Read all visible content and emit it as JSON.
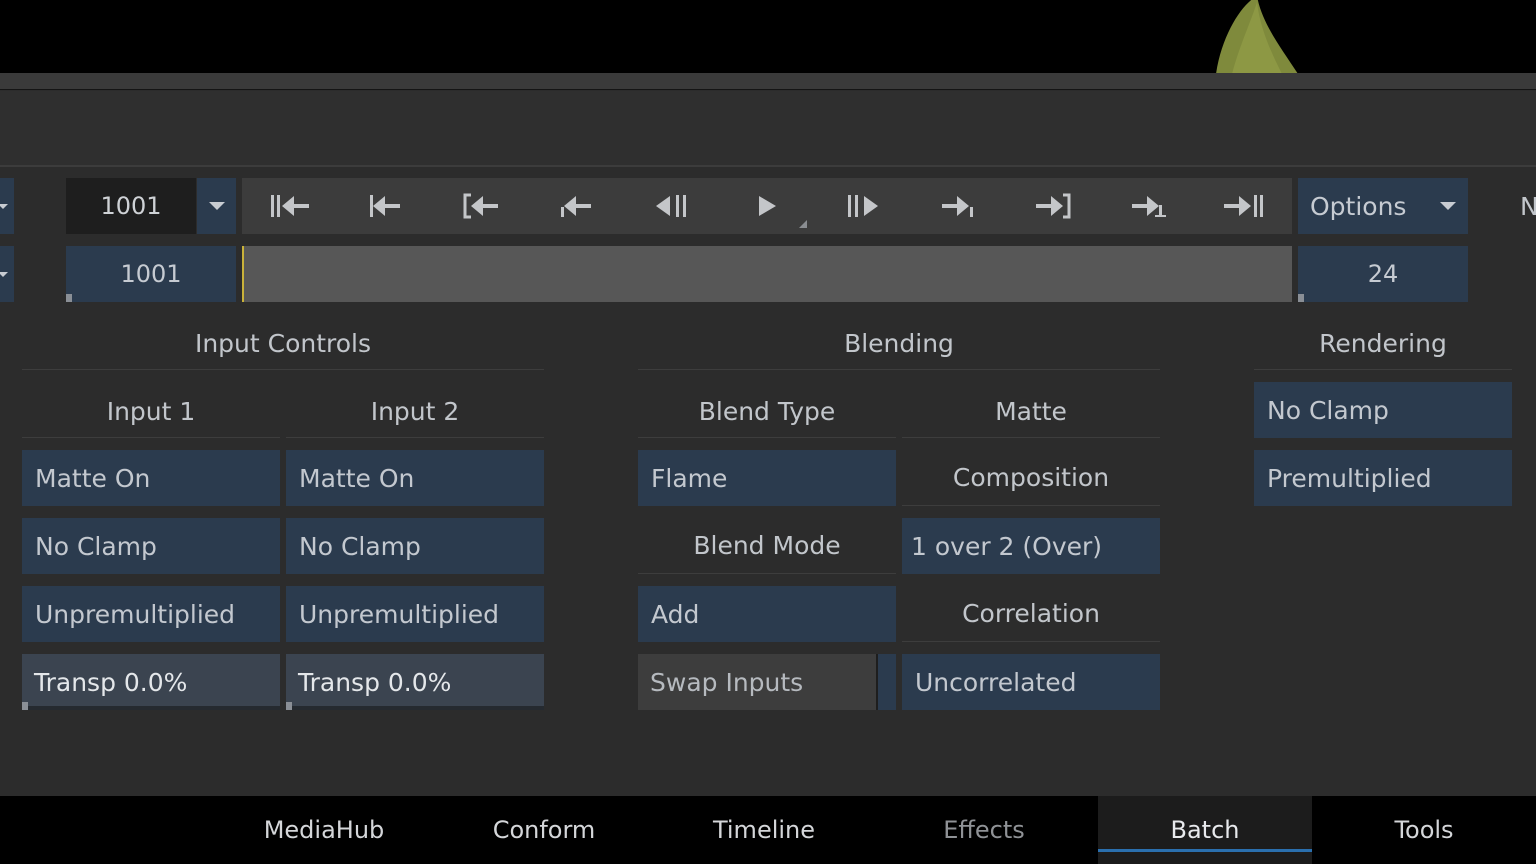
{
  "player": {
    "current_frame": "1001",
    "start_frame": "1001",
    "fps": "24",
    "options_label": "Options",
    "edge_letter": "N",
    "transport_buttons": [
      "goto-start",
      "prev-keyframe",
      "goto-in",
      "prev-mark",
      "step-back",
      "play",
      "step-forward",
      "next-mark",
      "goto-out",
      "next-keyframe",
      "goto-end"
    ]
  },
  "input_controls": {
    "title": "Input Controls",
    "input1": {
      "label": "Input 1",
      "matte": "Matte On",
      "clamp": "No Clamp",
      "premult": "Unpremultiplied",
      "transp": "Transp 0.0%"
    },
    "input2": {
      "label": "Input 2",
      "matte": "Matte On",
      "clamp": "No Clamp",
      "premult": "Unpremultiplied",
      "transp": "Transp 0.0%"
    }
  },
  "blending": {
    "title": "Blending",
    "blend_type_label": "Blend Type",
    "blend_type_value": "Flame",
    "matte_label": "Matte",
    "composition_label": "Composition",
    "composition_value": "1 over 2 (Over)",
    "blend_mode_label": "Blend Mode",
    "blend_mode_value": "Add",
    "correlation_label": "Correlation",
    "correlation_value": "Uncorrelated",
    "swap_inputs_label": "Swap Inputs"
  },
  "rendering": {
    "title": "Rendering",
    "clamp": "No Clamp",
    "premult": "Premultiplied"
  },
  "tabs": [
    {
      "label": "MediaHub"
    },
    {
      "label": "Conform"
    },
    {
      "label": "Timeline"
    },
    {
      "label": "Effects"
    },
    {
      "label": "Batch"
    },
    {
      "label": "Tools"
    }
  ],
  "colors": {
    "accent": "#2a6fae",
    "button_blue": "#2b3b4e",
    "playhead": "#c9b23a"
  }
}
